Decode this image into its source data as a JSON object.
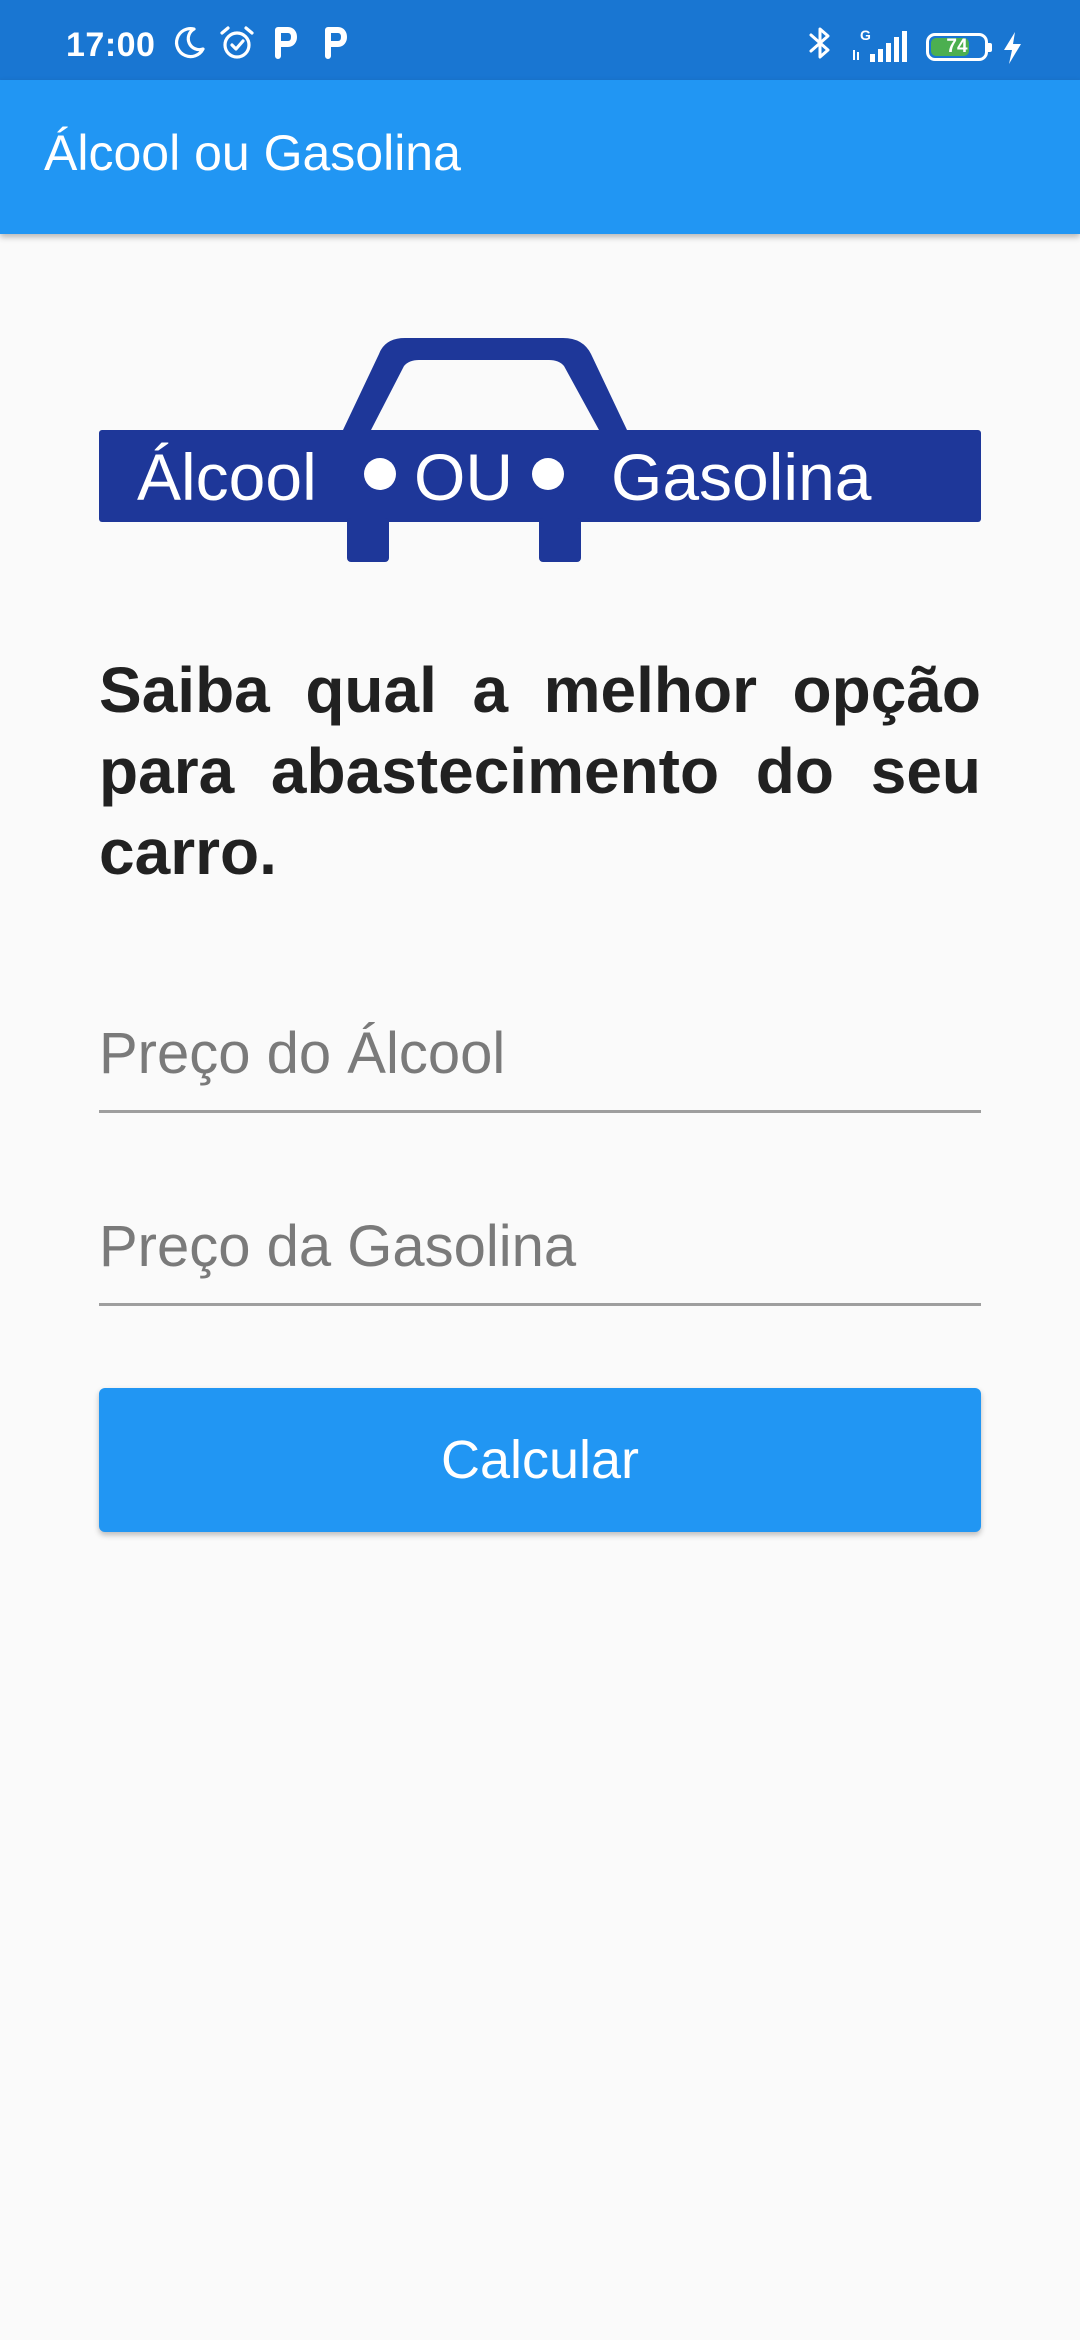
{
  "status_bar": {
    "time": "17:00",
    "battery_level": "74",
    "battery_fraction": 0.74,
    "network_label": "G",
    "icons": [
      "moon-icon",
      "alarm-icon",
      "parking-icon",
      "parking-icon",
      "bluetooth-icon",
      "signal-icon",
      "battery-icon",
      "charging-icon"
    ],
    "battery_color": "#4caf50"
  },
  "app_bar": {
    "title": "Álcool ou Gasolina",
    "color": "#2196f3"
  },
  "logo": {
    "word_left": "Álcool",
    "word_middle": "OU",
    "word_right": "Gasolina",
    "color": "#1e3799"
  },
  "main": {
    "headline": "Saiba qual a melhor opção para abastecimento do seu carro.",
    "alcool_field": {
      "placeholder": "Preço do Álcool",
      "value": ""
    },
    "gasolina_field": {
      "placeholder": "Preço da Gasolina",
      "value": ""
    },
    "calculate_button": "Calcular"
  }
}
